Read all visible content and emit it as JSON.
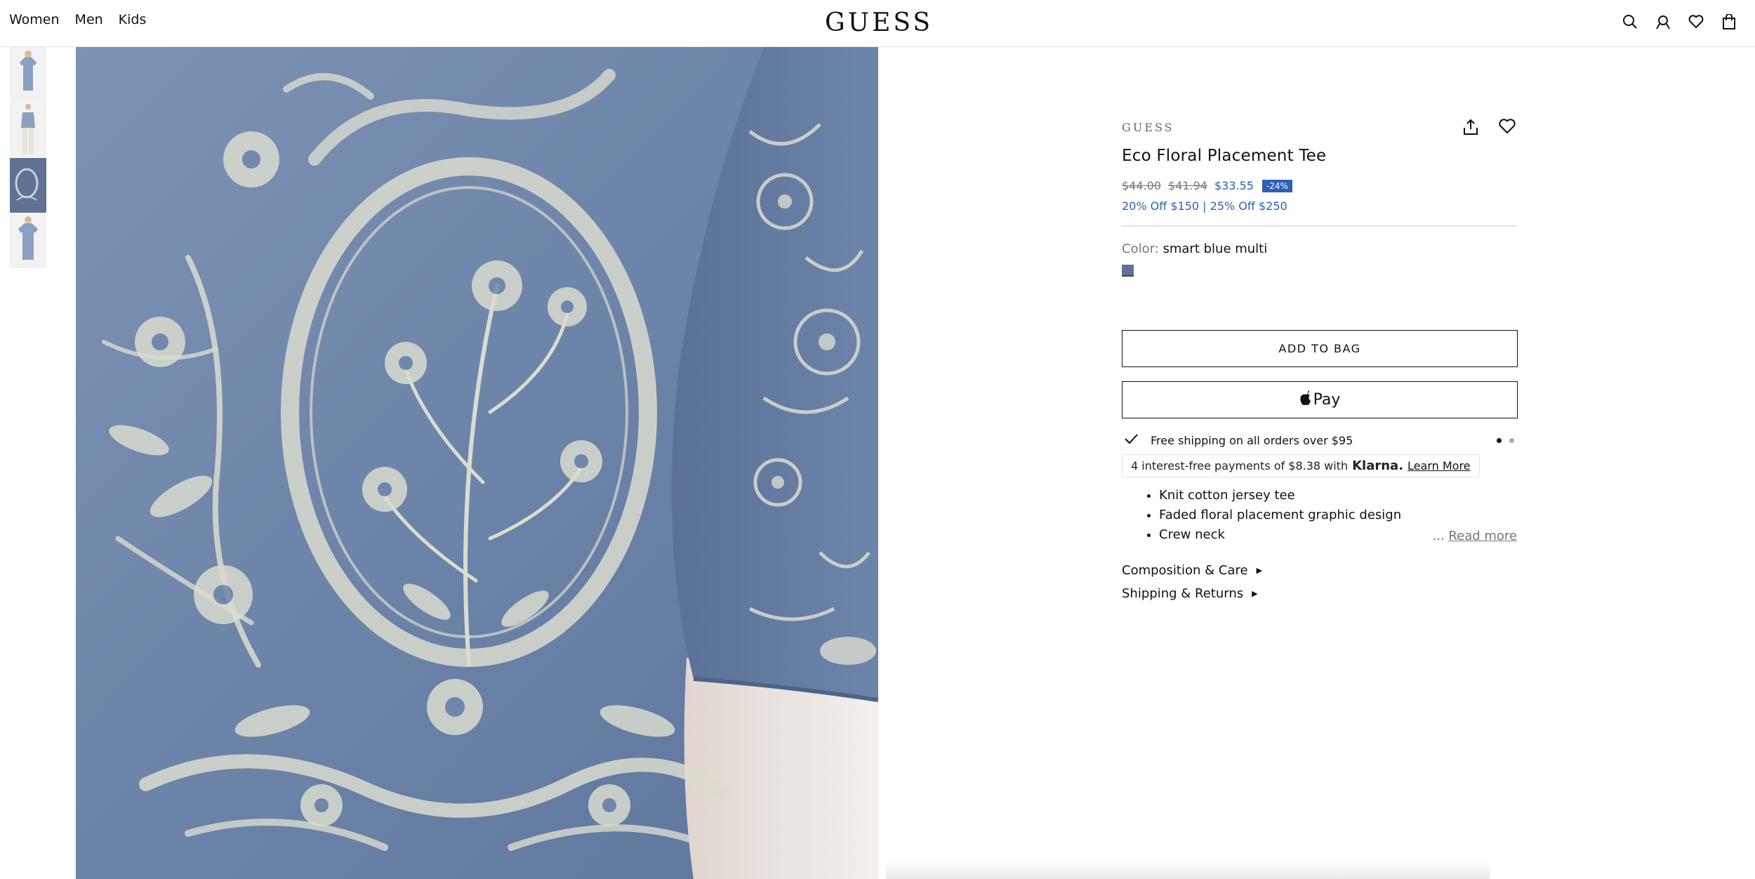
{
  "header": {
    "nav": [
      "Women",
      "Men",
      "Kids"
    ],
    "logo": "GUESS",
    "icons": [
      "search-icon",
      "account-icon",
      "wishlist-icon",
      "bag-icon"
    ]
  },
  "gallery": {
    "thumbnails": [
      "front view",
      "full body view",
      "back detail view",
      "front view alt"
    ],
    "active_index": 2
  },
  "product": {
    "brand": "GUESS",
    "title": "Eco Floral Placement Tee",
    "price_original": "$44.00",
    "price_previous": "$41.94",
    "price_sale": "$33.55",
    "discount_badge": "-24%",
    "promo": "20% Off $150 | 25% Off $250",
    "color_label": "Color:",
    "color_value": "smart blue multi",
    "swatch_color": "#5f7294",
    "add_to_bag": "ADD TO BAG",
    "apple_pay": "Pay",
    "shipping_text": "Free shipping on all orders over $95",
    "klarna": {
      "text": "4 interest-free payments of $8.38 with",
      "logo": "Klarna.",
      "link": "Learn More"
    },
    "features": [
      "Knit cotton jersey tee",
      "Faded floral placement graphic design",
      "Crew neck"
    ],
    "read_more": "Read more",
    "read_more_prefix": "...",
    "accordion": [
      "Composition & Care",
      "Shipping & Returns"
    ]
  },
  "colors": {
    "accent": "#2d5fb8",
    "shirt": "#7088ac",
    "print": "#d9dccf"
  }
}
